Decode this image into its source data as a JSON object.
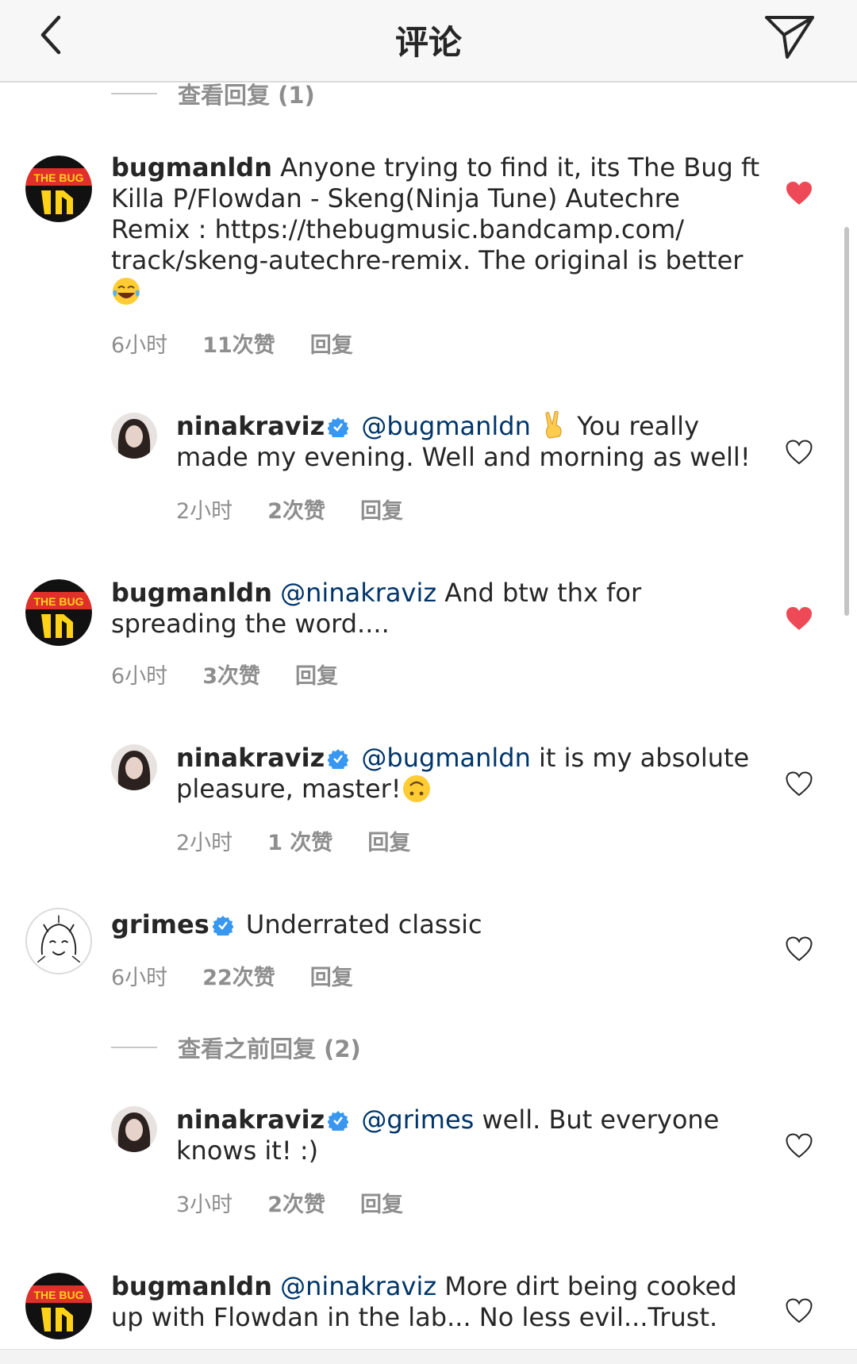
{
  "header": {
    "title": "评论"
  },
  "view_replies_top": "查看回复 (1)",
  "view_previous": "查看之前回复 (2)",
  "comments": [
    {
      "username": "bugmanldn",
      "pre": "",
      "mention": "",
      "text": "Anyone trying to find it, its The Bug ft Killa P/Flowdan - Skeng(Ninja Tune) Autechre Remix : https://thebugmusic.bandcamp.com/ track/skeng-autechre-remix. The original is better",
      "time": "6小时",
      "likes": "11次赞",
      "reply": "回复",
      "liked": true,
      "emoji": "joy"
    },
    {
      "username": "ninakraviz",
      "mention": "@bugmanldn",
      "text": "You really made my evening. Well and morning as well!",
      "time": "2小时",
      "likes": "2次赞",
      "reply": "回复",
      "liked": false,
      "emoji": "victory"
    },
    {
      "username": "bugmanldn",
      "mention": "@ninakraviz",
      "text": "And btw thx for spreading the word....",
      "time": "6小时",
      "likes": "3次赞",
      "reply": "回复",
      "liked": true
    },
    {
      "username": "ninakraviz",
      "mention": "@bugmanldn",
      "text": "it is my absolute pleasure, master!",
      "time": "2小时",
      "likes": "1 次赞",
      "reply": "回复",
      "liked": false,
      "emoji": "upside"
    },
    {
      "username": "grimes",
      "mention": "",
      "text": "Underrated classic",
      "time": "6小时",
      "likes": "22次赞",
      "reply": "回复",
      "liked": false
    },
    {
      "username": "ninakraviz",
      "mention": "@grimes",
      "text": "well. But everyone knows it! :)",
      "time": "3小时",
      "likes": "2次赞",
      "reply": "回复",
      "liked": false
    },
    {
      "username": "bugmanldn",
      "mention": "@ninakraviz",
      "text": "More dirt being cooked up with Flowdan in the lab... No less evil...Trust.",
      "liked": false
    }
  ],
  "avatar_text": {
    "bug": "THE BUG"
  },
  "colors": {
    "heart_liked": "#ed4956",
    "mention": "#003569",
    "verified": "#3897f0",
    "meta": "#8e8e8e"
  }
}
